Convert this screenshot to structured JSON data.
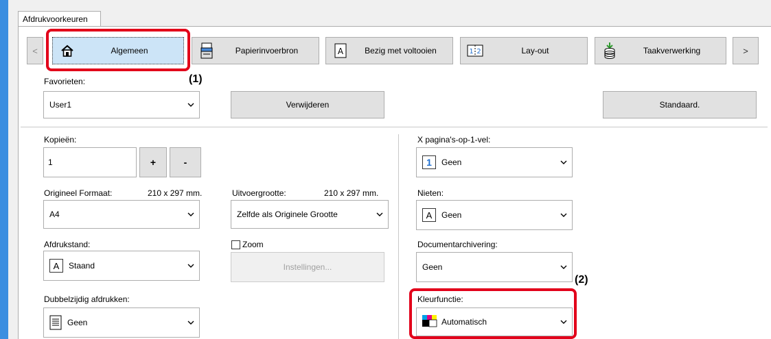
{
  "window": {
    "tab_title": "Afdrukvoorkeuren"
  },
  "nav": {
    "prev_label": "<",
    "next_label": ">",
    "tabs": [
      {
        "label": "Algemeen",
        "icon": "home-icon",
        "selected": true
      },
      {
        "label": "Papierinvoerbron",
        "icon": "paper-tray-icon"
      },
      {
        "label": "Bezig met voltooien",
        "icon": "finishing-icon"
      },
      {
        "label": "Lay-out",
        "icon": "layout-icon"
      },
      {
        "label": "Taakverwerking",
        "icon": "job-handling-icon"
      }
    ]
  },
  "favorites": {
    "label": "Favorieten:",
    "value": "User1",
    "delete_label": "Verwijderen",
    "default_label": "Standaard."
  },
  "copies": {
    "label": "Kopieën:",
    "value": "1",
    "plus_label": "+",
    "minus_label": "-"
  },
  "original_size": {
    "label": "Origineel Formaat:",
    "dims": "210 x 297 mm.",
    "value": "A4"
  },
  "output_size": {
    "label": "Uitvoergrootte:",
    "dims": "210 x 297 mm.",
    "value": "Zelfde als Originele Grootte"
  },
  "orientation": {
    "label": "Afdrukstand:",
    "value": "Staand",
    "icon_glyph": "A"
  },
  "zoom": {
    "label": "Zoom",
    "checked": false,
    "settings_label": "Instellingen..."
  },
  "duplex": {
    "label": "Dubbelzijdig afdrukken:",
    "value": "Geen"
  },
  "n_up": {
    "label": "X pagina's-op-1-vel:",
    "value": "Geen",
    "icon_glyph": "1"
  },
  "staple": {
    "label": "Nieten:",
    "value": "Geen",
    "icon_glyph": "A"
  },
  "doc_filing": {
    "label": "Documentarchivering:",
    "value": "Geen"
  },
  "color_mode": {
    "label": "Kleurfunctie:",
    "value": "Automatisch"
  },
  "callouts": {
    "one": "(1)",
    "two": "(2)"
  },
  "colors": {
    "callout_red": "#e2001a",
    "accent_blue": "#3c8ee0",
    "nav_number_blue": "#1e6fd0"
  }
}
